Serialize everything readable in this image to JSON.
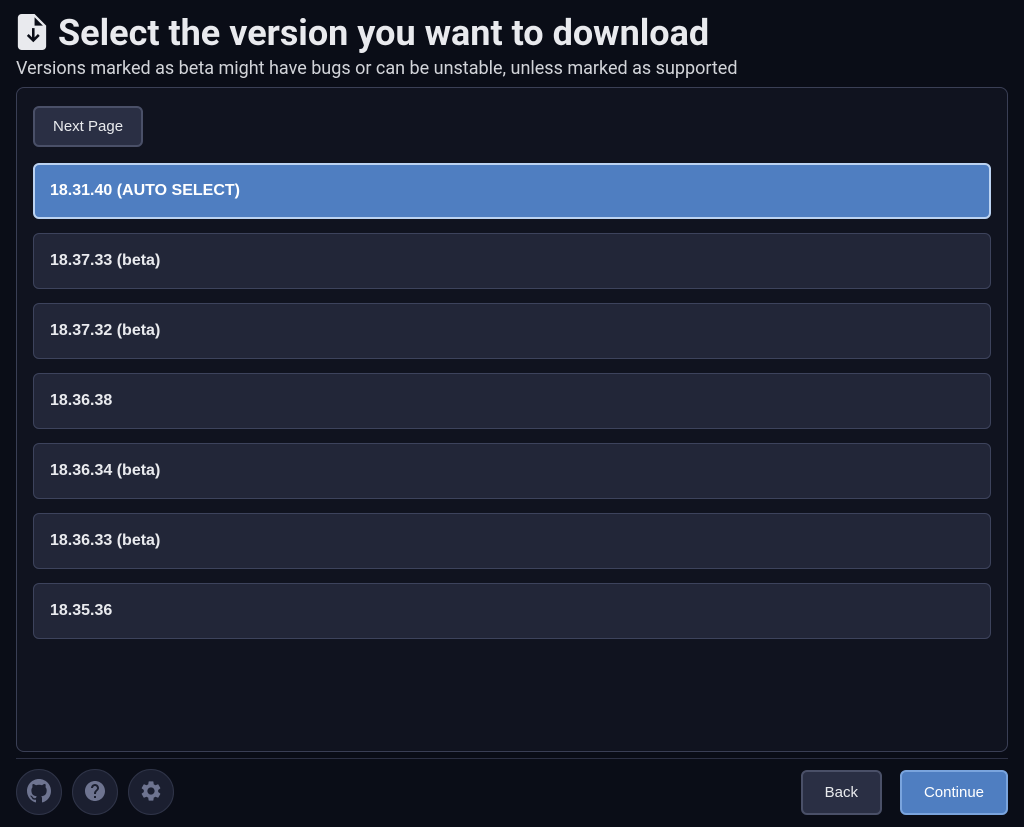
{
  "header": {
    "title": "Select the version you want to download",
    "subtitle": "Versions marked as beta might have bugs or can be unstable, unless marked as supported"
  },
  "panel": {
    "next_page_label": "Next Page",
    "versions": [
      {
        "label": "18.31.40 (AUTO SELECT)",
        "selected": true
      },
      {
        "label": "18.37.33 (beta)",
        "selected": false
      },
      {
        "label": "18.37.32 (beta)",
        "selected": false
      },
      {
        "label": "18.36.38",
        "selected": false
      },
      {
        "label": "18.36.34 (beta)",
        "selected": false
      },
      {
        "label": "18.36.33 (beta)",
        "selected": false
      },
      {
        "label": "18.35.36",
        "selected": false
      }
    ]
  },
  "footer": {
    "back_label": "Back",
    "continue_label": "Continue"
  }
}
